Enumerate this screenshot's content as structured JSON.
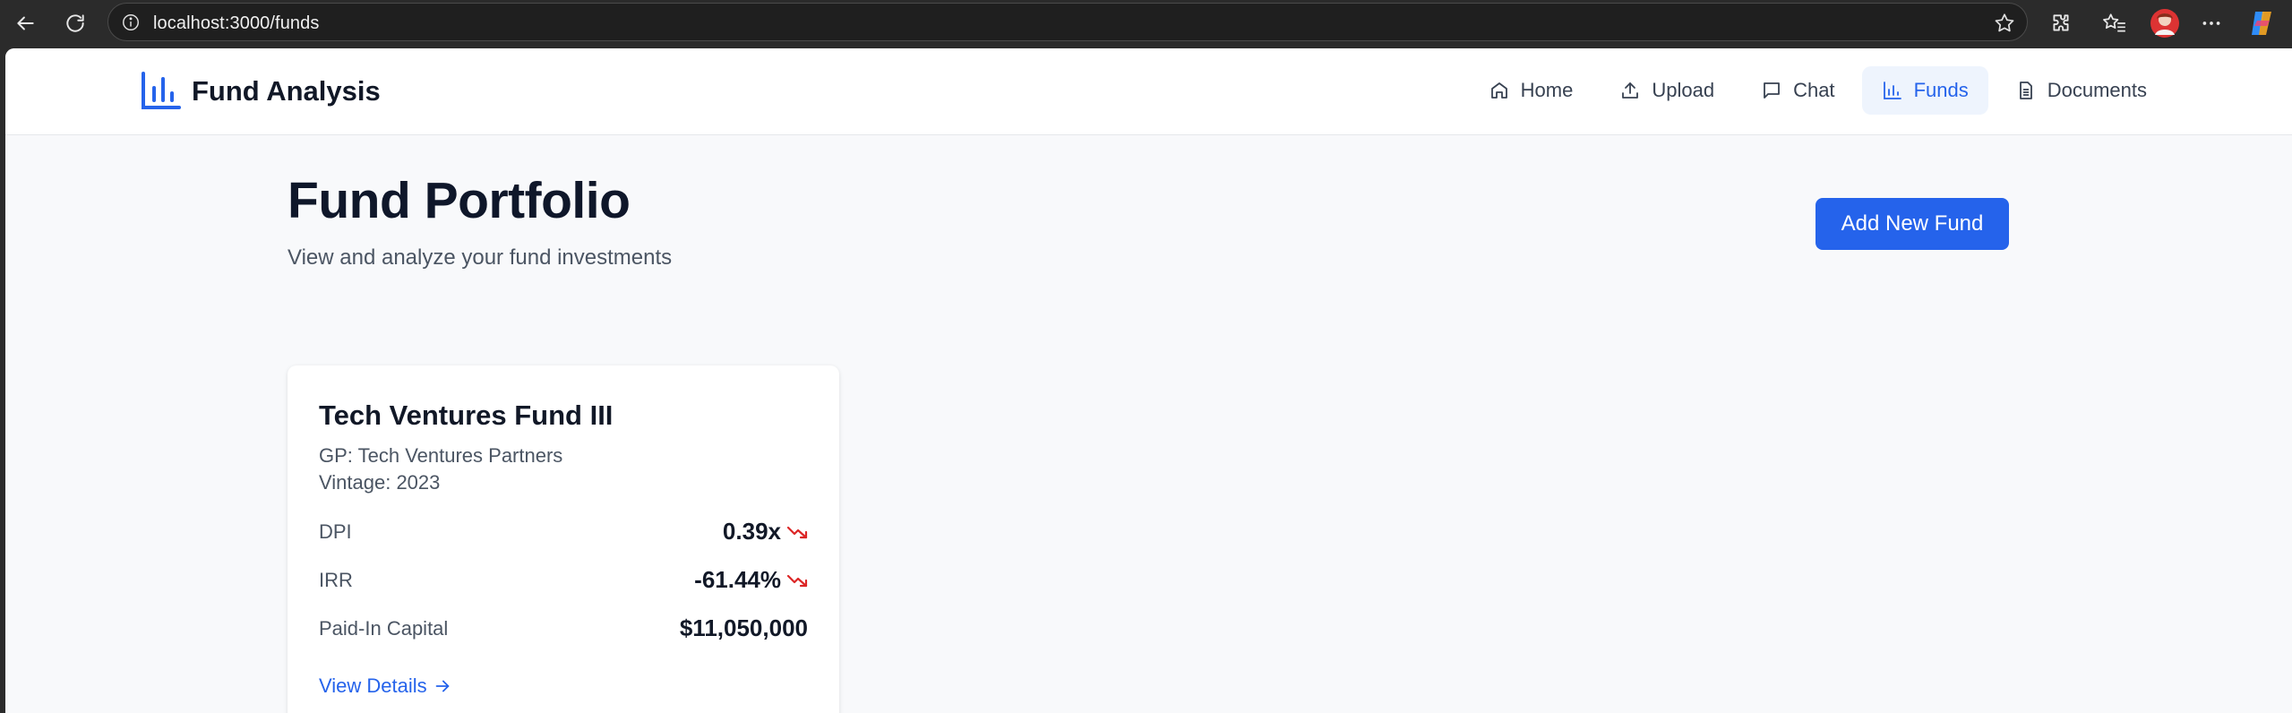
{
  "browser": {
    "url": "localhost:3000/funds",
    "icons": [
      "back-icon",
      "reload-icon",
      "info-icon",
      "star-icon",
      "extensions-icon",
      "favorites-icon",
      "profile-avatar",
      "more-icon",
      "copilot-icon"
    ]
  },
  "app": {
    "title": "Fund Analysis",
    "accent_color": "#2563eb"
  },
  "nav": {
    "items": [
      {
        "label": "Home",
        "icon": "home-icon",
        "active": false
      },
      {
        "label": "Upload",
        "icon": "upload-icon",
        "active": false
      },
      {
        "label": "Chat",
        "icon": "chat-icon",
        "active": false
      },
      {
        "label": "Funds",
        "icon": "bar-chart-icon",
        "active": true
      },
      {
        "label": "Documents",
        "icon": "document-icon",
        "active": false
      }
    ]
  },
  "page": {
    "title": "Fund Portfolio",
    "subtitle": "View and analyze your fund investments",
    "add_button": "Add New Fund"
  },
  "fund_card": {
    "name": "Tech Ventures Fund III",
    "gp": "GP: Tech Ventures Partners",
    "vintage": "Vintage: 2023",
    "metrics": [
      {
        "label": "DPI",
        "value": "0.39x",
        "trend": "down"
      },
      {
        "label": "IRR",
        "value": "-61.44%",
        "trend": "down"
      },
      {
        "label": "Paid-In Capital",
        "value": "$11,050,000",
        "trend": ""
      }
    ],
    "link": "View Details",
    "trend_color": "#dc2626"
  }
}
